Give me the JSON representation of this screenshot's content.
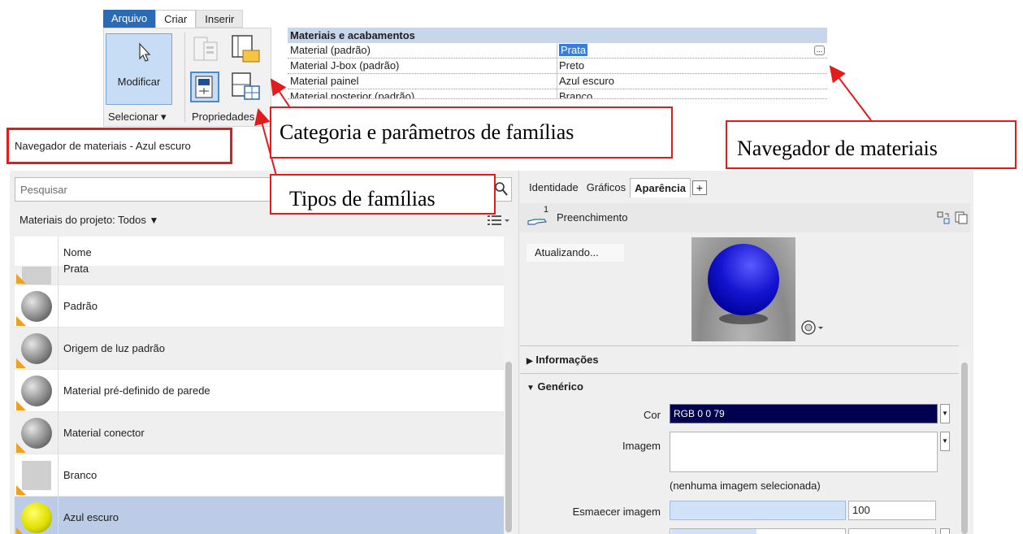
{
  "ribbon": {
    "tabs": [
      {
        "label": "Arquivo"
      },
      {
        "label": "Criar"
      },
      {
        "label": "Inserir"
      }
    ],
    "modificar_label": "Modificar",
    "selecionar_label": "Selecionar ▾",
    "propriedades_label": "Propriedades"
  },
  "properties_table": {
    "header": "Materiais e acabamentos",
    "rows": [
      {
        "name": "Material (padrão)",
        "value": "Prata",
        "selected": true
      },
      {
        "name": "Material J-box (padrão)",
        "value": "Preto"
      },
      {
        "name": "Material painel",
        "value": "Azul escuro"
      },
      {
        "name": "Material posterior (padrão)",
        "value": "Branco"
      }
    ],
    "browse_button": "..."
  },
  "callouts": {
    "categoria": "Categoria e parâmetros de famílias",
    "navegador": "Navegador de materiais",
    "tipos": "Tipos de famílias"
  },
  "material_browser": {
    "title": "Navegador de materiais - Azul escuro",
    "search_placeholder": "Pesquisar",
    "filter_label": "Materiais do projeto: Todos",
    "column_name": "Nome",
    "materials": [
      {
        "name": "Prata",
        "thumb": "flat"
      },
      {
        "name": "Padrão",
        "thumb": "sphere"
      },
      {
        "name": "Origem de luz padrão",
        "thumb": "sphere"
      },
      {
        "name": "Material pré-definido de parede",
        "thumb": "sphere"
      },
      {
        "name": "Material conector",
        "thumb": "sphere"
      },
      {
        "name": "Branco",
        "thumb": "flat"
      },
      {
        "name": "Azul escuro",
        "thumb": "yellow-sphere",
        "selected": true
      }
    ]
  },
  "editor": {
    "tabs": [
      {
        "label": "Identidade"
      },
      {
        "label": "Gráficos"
      },
      {
        "label": "Aparência",
        "active": true
      }
    ],
    "add_tab": "+",
    "asset_count": "1",
    "asset_name": "Preenchimento",
    "updating": "Atualizando...",
    "sections": {
      "info": "Informações",
      "generic": "Genérico"
    },
    "fields": {
      "cor_label": "Cor",
      "cor_value": "RGB 0 0 79",
      "imagem_label": "Imagem",
      "imagem_note": "(nenhuma imagem selecionada)",
      "esmaecer_label": "Esmaecer imagem",
      "esmaecer_value": "100"
    },
    "colors": {
      "cor_swatch": "#00004F",
      "accent": "#2b6bb5",
      "callout_red": "#e31b1b"
    }
  }
}
